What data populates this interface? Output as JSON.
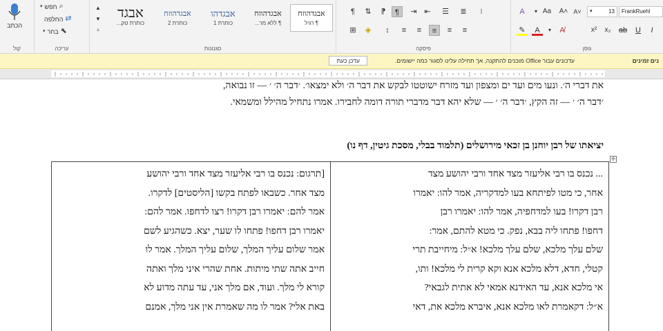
{
  "ribbon": {
    "font_group_label": "גופן",
    "paragraph_group_label": "פיסקה",
    "styles_group_label": "סגנונות",
    "editing_group_label": "עריכה",
    "voice_group_label": "קול",
    "font_name": "FrankRuehl",
    "font_size": "13",
    "styles": [
      {
        "sample": "אבגדהוזח",
        "name": "¶ רגיל"
      },
      {
        "sample": "אבגדהוזח",
        "name": "¶ ללא מר..."
      },
      {
        "sample": "אבגדהו",
        "name": "כותרת 1"
      },
      {
        "sample": "אבגדהוזח",
        "name": "כותרת 2"
      },
      {
        "sample": "אבגד",
        "name": "כותרת טק..."
      }
    ],
    "find_label": "חפש",
    "replace_label": "החלפה",
    "select_label": "בחר",
    "dictate_label": "הכתב"
  },
  "notification": {
    "title": "נים זמינים",
    "message": "עדכונים עבור Office מוכנים להתקנה, אך תחילה עלינו לסגור כמה יישומים.",
    "button": "עדכן כעת"
  },
  "document": {
    "para_lines": [
      "את דברי ה׳. ונעו מים ועד ים ומצפון ועד מזרח ישוטטו לבקש את דבר ה׳ ולא ימצאו׳. ׳דבר ה׳ ׳ — זו נבואה,",
      "׳דבר ה׳ ׳ — זה הקץ, ׳דבר ה׳ ׳ — שלא יהא דבר מדברי תורה דומה לחבירו. אמרו נתחיל מהילל ומשמאי."
    ],
    "heading": "יציאתו של רבן יוחנן בן זכאי מירושלים (תלמוד בבלי, מסכת גיטין, דף נו)",
    "col_right_lines": [
      "... נכנס בו רבי אליעזר מצד אחד ורבי יהושע מצד",
      "אחר, כי מטו לפיתחא בעו למדקריה, אמר להו: יאמרו",
      "רבן דקרו! בעו למדחפיה, אמר להו: יאמרו רבן",
      "דחפו! פתחו ליה בבא, נפק. כי מטא להתם, אמר:",
      "שלם עלך מלכא, שלם עלך מלכא! א״ל: מיחייבת תרי",
      "קטלי, חדא, דלא מלכא אנא וקא קרית לי מלכא! ותו,",
      "אי מלכא אנא, עד האידנא אמאי לא אתית לגבאי?",
      "א״ל: דקאמרת לאו מלכא אנא, איברא מלכא את, דאי"
    ],
    "col_left_lines": [
      "[תרגום: נכנס בו רבי אליעזר מצד אחד ורבי יהושע",
      "מצד אחר. כשבאו לפתח בקשו [הליסטים] לדקרו.",
      "אמר להם: יאמרו רבן דקרו! רצו לדחפו. אמר להם:",
      "יאמרו רבן דחפו! פתחו לו שער, יצא. כשהגיע לשם",
      "אמר שלום עליך המלך, שלום עליך המלך. אמר לו",
      "חייב אתה שתי מיתות. אחת שהרי איני מלך ואתה",
      "קורא לי מלך. ועוד, אם מלך אני, עד עתה מדוע לא",
      "באת אלי? אמר לו מה שאמרת אין אני מלך, אמנם"
    ]
  }
}
